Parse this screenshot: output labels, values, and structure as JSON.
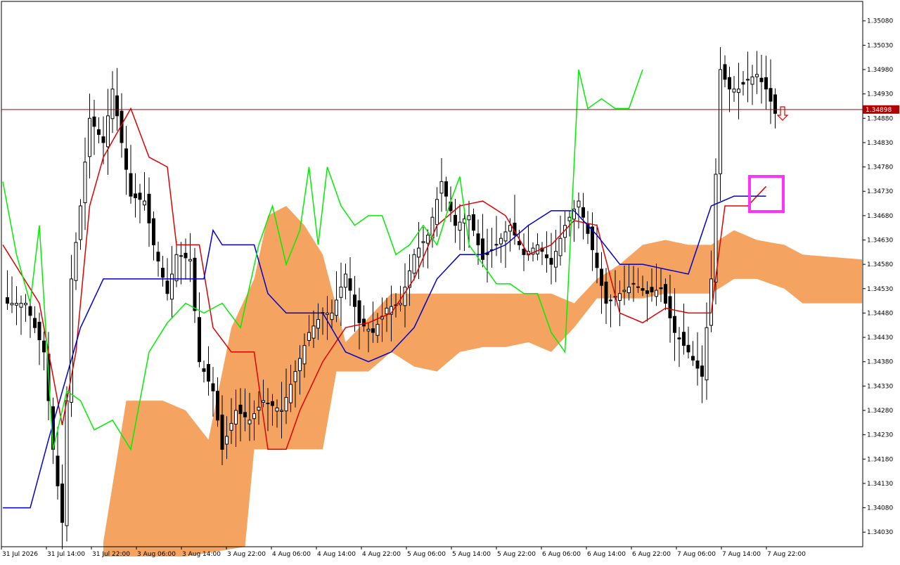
{
  "chart_data": {
    "type": "candlestick",
    "symbol_price_label": "1.34898",
    "current_price": 1.34898,
    "ylim": [
      1.34,
      1.3512
    ],
    "y_ticks": [
      "1.35080",
      "1.35030",
      "1.34980",
      "1.34930",
      "1.34880",
      "1.34830",
      "1.34780",
      "1.34730",
      "1.34680",
      "1.34630",
      "1.34580",
      "1.34530",
      "1.34480",
      "1.34430",
      "1.34380",
      "1.34330",
      "1.34280",
      "1.34230",
      "1.34180",
      "1.34130",
      "1.34080",
      "1.34030"
    ],
    "x_ticks": [
      "31 Jul 2026",
      "31 Jul 14:00",
      "31 Jul 22:00",
      "3 Aug 06:00",
      "3 Aug 14:00",
      "3 Aug 22:00",
      "4 Aug 06:00",
      "4 Aug 14:00",
      "4 Aug 22:00",
      "5 Aug 06:00",
      "5 Aug 14:00",
      "5 Aug 22:00",
      "6 Aug 06:00",
      "6 Aug 14:00",
      "6 Aug 22:00",
      "7 Aug 06:00",
      "7 Aug 14:00",
      "7 Aug 22:00"
    ],
    "colors": {
      "tenkan": "#dd0000",
      "kijun": "#0000cc",
      "chikou": "#00ee00",
      "kumo_bull": "#f4a460",
      "kumo_bear": "#d8bfd8",
      "price_line": "#b00000",
      "highlight_box": "#ff33ff",
      "arrow": "#e00000"
    }
  }
}
